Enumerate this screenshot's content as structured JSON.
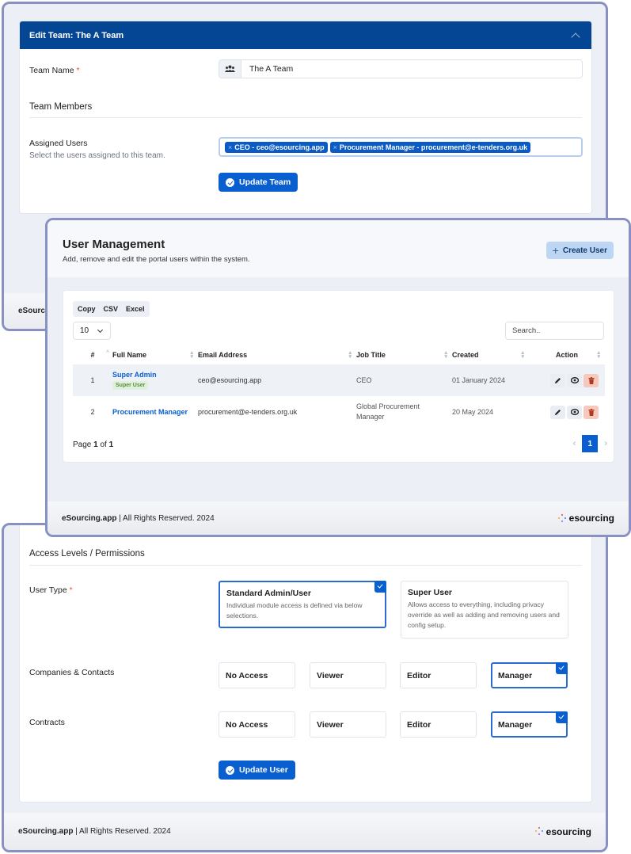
{
  "edit_team": {
    "header_title": "Edit Team: The A Team",
    "team_name_label": "Team Name",
    "required_mark": "*",
    "team_name_value": "The A Team",
    "team_members_title": "Team Members",
    "assigned_users_label": "Assigned Users",
    "assigned_users_help": "Select the users assigned to this team.",
    "assigned_users": [
      {
        "remove": "×",
        "label": "CEO - ceo@esourcing.app"
      },
      {
        "remove": "×",
        "label": "Procurement Manager - procurement@e-tenders.org.uk"
      }
    ],
    "update_button": "Update Team",
    "footer_partial": "eSourci"
  },
  "user_management": {
    "title": "User Management",
    "subtitle": "Add, remove and edit the portal users within the system.",
    "create_button": "Create User",
    "create_icon": "+",
    "export_buttons": [
      "Copy",
      "CSV",
      "Excel"
    ],
    "page_length": "10",
    "search_placeholder": "Search..",
    "columns": [
      "#",
      "Full Name",
      "Email Address",
      "Job Title",
      "Created",
      "Action"
    ],
    "rows": [
      {
        "num": "1",
        "name": "Super Admin",
        "badge": "Super User",
        "email": "ceo@esourcing.app",
        "job_title": "CEO",
        "created": "01 January 2024"
      },
      {
        "num": "2",
        "name": "Procurement Manager",
        "badge": "",
        "email": "procurement@e-tenders.org.uk",
        "job_title": "Global Procurement Manager",
        "created": "20 May 2024"
      }
    ],
    "pager": {
      "prefix": "Page ",
      "current": "1",
      "of": " of ",
      "total": "1",
      "prev": "‹",
      "next": "›",
      "active_page": "1"
    },
    "footer_brand": "eSourcing.app",
    "footer_text": " | All Rights Reserved. 2024",
    "logo_text": "esourcing"
  },
  "access_levels": {
    "title": "Access Levels / Permissions",
    "user_type_label": "User Type",
    "required_mark": "*",
    "user_types": [
      {
        "title": "Standard Admin/User",
        "desc": "Individual module access is defined via below selections.",
        "selected": true
      },
      {
        "title": "Super User",
        "desc": "Allows access to everything, including privacy override as well as adding and removing users and config setup.",
        "selected": false
      }
    ],
    "modules": [
      {
        "label": "Companies & Contacts",
        "options": [
          "No Access",
          "Viewer",
          "Editor",
          "Manager"
        ],
        "selected": "Manager"
      },
      {
        "label": "Contracts",
        "options": [
          "No Access",
          "Viewer",
          "Editor",
          "Manager"
        ],
        "selected": "Manager"
      }
    ],
    "update_button": "Update User",
    "footer_brand": "eSourcing.app",
    "footer_text": " | All Rights Reserved. 2024",
    "logo_text": "esourcing"
  },
  "colors": {
    "header_blue": "#054694",
    "primary": "#0a5fd0",
    "window_border": "#8891c2",
    "delete_bg": "#f5c9bd",
    "badge_green": "#5f8d3e"
  }
}
